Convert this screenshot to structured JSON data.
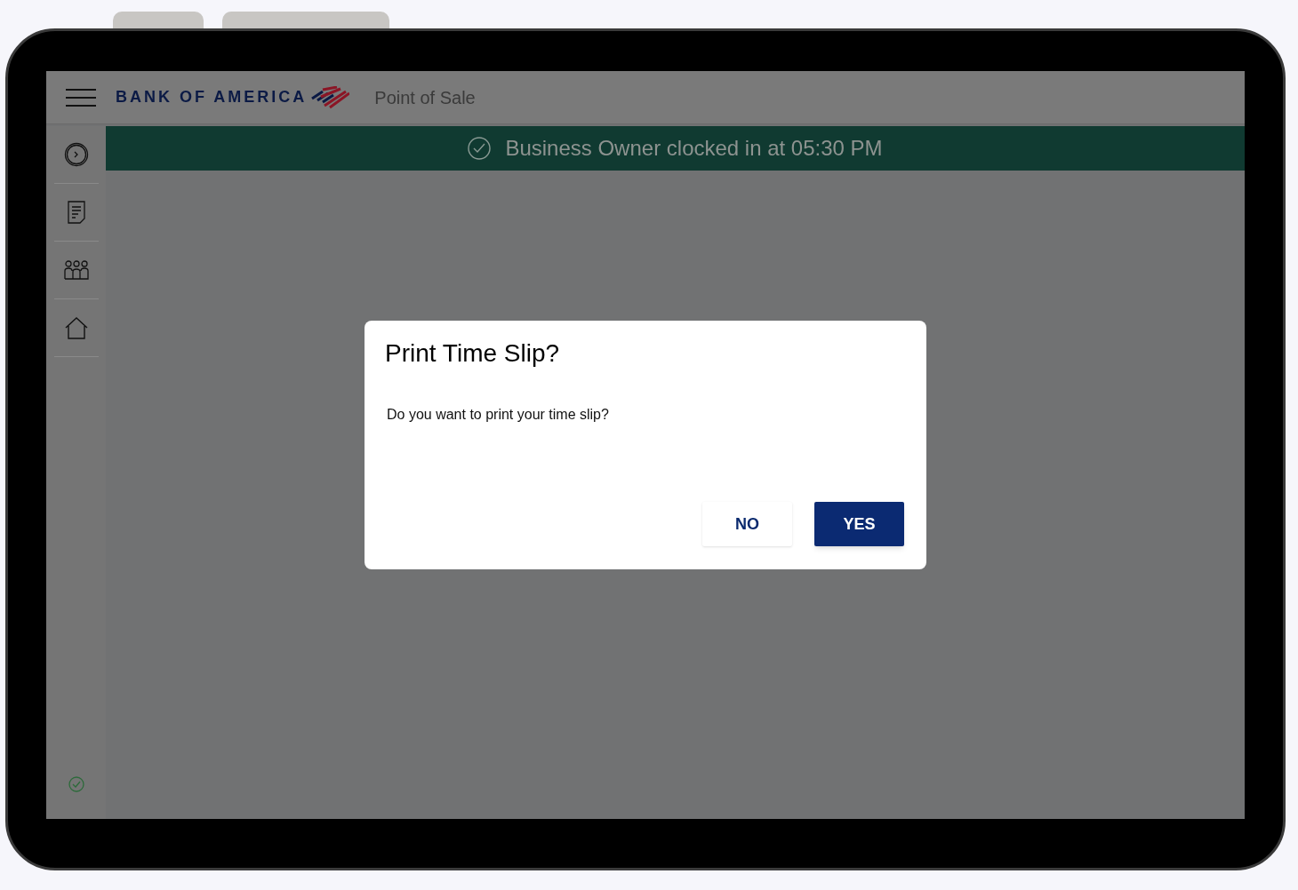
{
  "header": {
    "brand": "BANK OF AMERICA",
    "title": "Point of Sale"
  },
  "banner": {
    "text": "Business Owner clocked in at 05:30 PM"
  },
  "dialog": {
    "title": "Print Time Slip?",
    "message": "Do you want to print your time slip?",
    "buttons": [
      {
        "label": "NO",
        "kind": "text"
      },
      {
        "label": "YES",
        "kind": "primary"
      }
    ]
  }
}
